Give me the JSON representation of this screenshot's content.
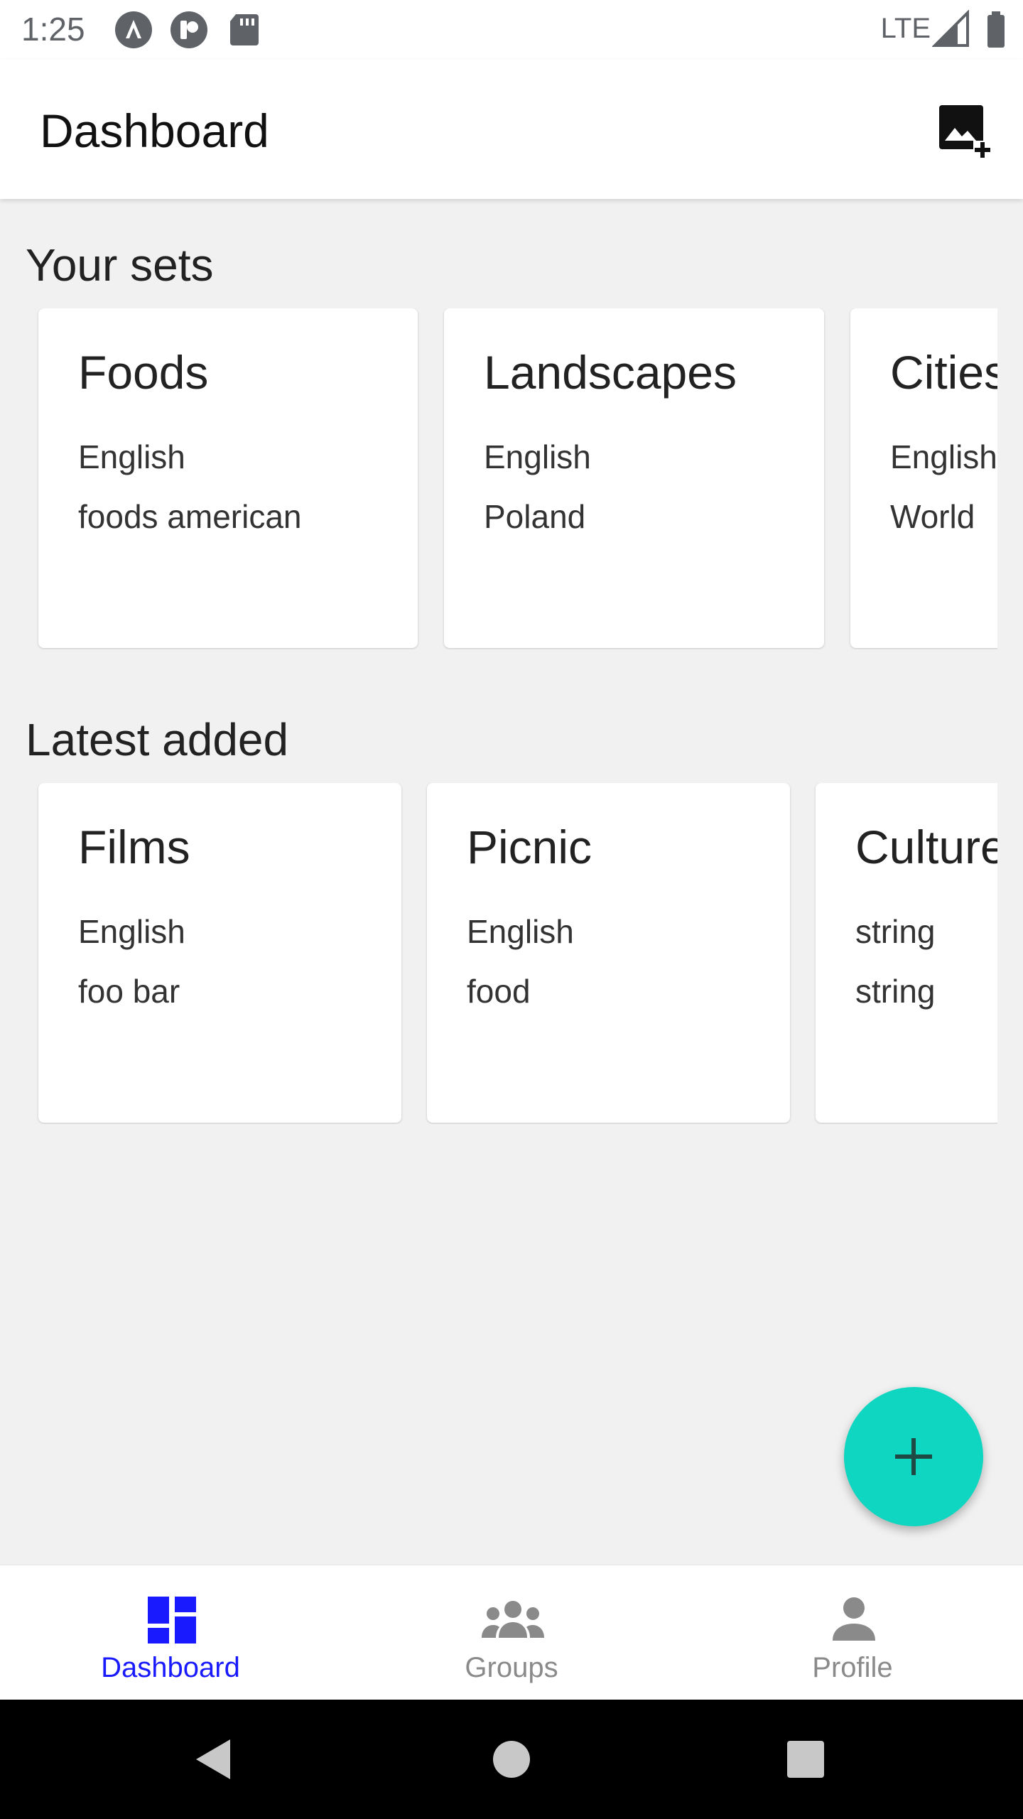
{
  "status_bar": {
    "time": "1:25",
    "network": "LTE",
    "icons": [
      "auto-icon",
      "app-notification-icon",
      "sd-card-icon",
      "signal-icon",
      "battery-icon"
    ]
  },
  "app_bar": {
    "title": "Dashboard",
    "action_icon": "add-photo-icon"
  },
  "sections": {
    "your_sets": {
      "title": "Your sets",
      "cards": [
        {
          "title": "Foods",
          "language": "English",
          "tags": "foods american"
        },
        {
          "title": "Landscapes",
          "language": "English",
          "tags": "Poland"
        },
        {
          "title": "Cities",
          "language": "English",
          "tags": "World"
        }
      ]
    },
    "latest_added": {
      "title": "Latest added",
      "cards": [
        {
          "title": "Films",
          "language": "English",
          "tags": "foo bar"
        },
        {
          "title": "Picnic",
          "language": "English",
          "tags": "food"
        },
        {
          "title": "Culture",
          "language": "string",
          "tags": "string"
        }
      ]
    }
  },
  "fab": {
    "icon": "plus-icon",
    "color": "#0fd6c0"
  },
  "bottom_nav": {
    "items": [
      {
        "label": "Dashboard",
        "icon": "dashboard-icon",
        "active": true
      },
      {
        "label": "Groups",
        "icon": "groups-icon",
        "active": false
      },
      {
        "label": "Profile",
        "icon": "person-icon",
        "active": false
      }
    ],
    "active_color": "#1a1aff",
    "inactive_color": "#8a8a8a"
  },
  "system_nav": {
    "buttons": [
      "back-icon",
      "home-icon",
      "recents-icon"
    ]
  }
}
